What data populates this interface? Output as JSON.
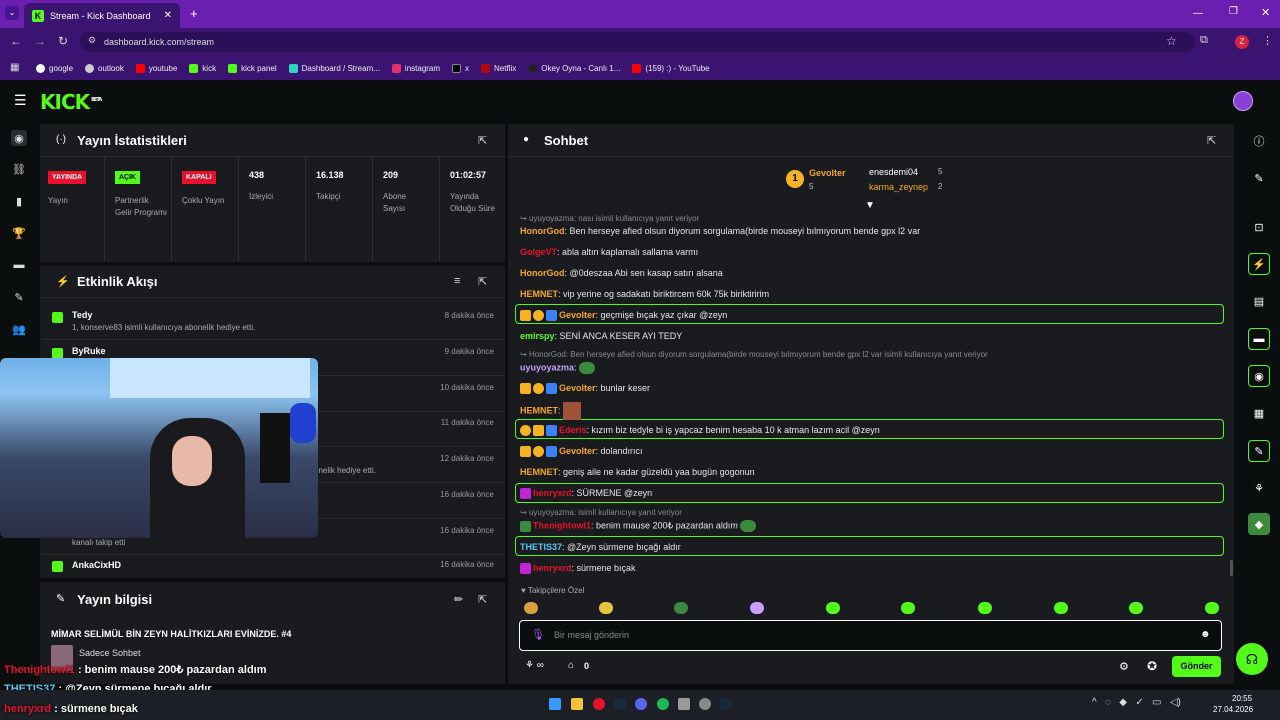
{
  "browser": {
    "tab_title": "Stream - Kick Dashboard",
    "url": "dashboard.kick.com/stream",
    "bookmarks": [
      "google",
      "outlook",
      "youtube",
      "kick",
      "kick panel",
      "Dashboard / Stream...",
      "instagram",
      "x",
      "Netflix",
      "Okey Oyna - Canlı 1...",
      "(159) :) - YouTube"
    ],
    "profile_initial": "Z"
  },
  "brand": {
    "logo": "KICK",
    "beta": "BETA"
  },
  "stats": {
    "title": "Yayın İstatistikleri",
    "items": [
      {
        "badge": "YAYINDA",
        "badge_color": "#e8102a",
        "label": "Yayın"
      },
      {
        "badge": "AÇIK",
        "badge_color": "#53fc18",
        "label": "Partnerlik Gelir Programı"
      },
      {
        "badge": "KAPALI",
        "badge_color": "#e8102a",
        "label": "Çoklu Yayın"
      },
      {
        "value": "438",
        "label": "İzleyici"
      },
      {
        "value": "16.138",
        "label": "Takipçi"
      },
      {
        "value": "209",
        "label": "Abone Sayısı"
      },
      {
        "value": "01:02:57",
        "label": "Yayında Olduğu Süre"
      }
    ]
  },
  "activity": {
    "title": "Etkinlik Akışı",
    "events": [
      {
        "name": "Tedy",
        "sub": "1, konserve83 isimli kullanıcıya abonelik hediye etti.",
        "time": "8 dakika önce"
      },
      {
        "name": "ByRuke",
        "sub": "",
        "time": "9 dakika önce"
      },
      {
        "name": "",
        "sub": "",
        "time": "10 dakika önce"
      },
      {
        "name": "",
        "sub": "",
        "time": "11 dakika önce"
      },
      {
        "name": "",
        "sub": "onelik hediye etti.",
        "time": "12 dakika önce"
      },
      {
        "name": "",
        "sub": "",
        "time": "16 dakika önce"
      },
      {
        "name": "",
        "sub": "kanalı takip etti",
        "time": "16 dakika önce"
      },
      {
        "name": "AnkaCixHD",
        "sub": "",
        "time": "16 dakika önce"
      }
    ]
  },
  "stream_info": {
    "title": "Yayın bilgisi",
    "stream_title": "MİMAR SELİMÜL BİN ZEYN HALİTKIZLARI EVİNİZDE. #4",
    "category": "Sadece Sohbet"
  },
  "chat": {
    "title": "Sohbet",
    "leaders": [
      {
        "name": "Gevolter",
        "count": "5"
      },
      {
        "name": "enesdemi04",
        "count": "5"
      },
      {
        "name": "karma_zeynep",
        "count": "2"
      }
    ],
    "rank_badge": "1",
    "messages": [
      {
        "type": "reply",
        "text": "uyuyoyazma: nası isimli kullanıcıya yanıt veriyor"
      },
      {
        "user": "HonorGod",
        "color": "#f5a623",
        "text": "Ben herseye afied olsun diyorum sorgulama(birde mouseyi bılmıyorum bende gpx l2 var"
      },
      {
        "user": "GolgeVT",
        "color": "#e8102a",
        "text": "abla altın kaplamalı sallama varmı"
      },
      {
        "user": "HonorGod",
        "color": "#f5a623",
        "text": "@0deszaa Abi sen kasap satırı alsana"
      },
      {
        "user": "HEMNET",
        "color": "#f5a623",
        "text": "vip yerine og sadakatı biriktircem 60k 75k biriktiririm"
      },
      {
        "user": "Gevolter",
        "color": "#f5a623",
        "text": "geçmişe bıçak yaz çıkar @zeyn",
        "highlight": true
      },
      {
        "user": "emirspy",
        "color": "#53fc18",
        "text": "SENİ ANCA KESER AYI TEDY"
      },
      {
        "type": "reply",
        "text": "HonorGod: Ben herseye afied olsun diyorum sorgulama(birde mouseyi bılmıyorum bende gpx l2 var isimli kullanıcıya yanıt veriyor"
      },
      {
        "user": "uyuyoyazma",
        "color": "#c9a0ff",
        "text": ""
      },
      {
        "user": "Gevolter",
        "color": "#f5a623",
        "text": "bunlar keser"
      },
      {
        "user": "HEMNET",
        "color": "#f5a623",
        "text": ""
      },
      {
        "user": "Ederis",
        "color": "#e8102a",
        "text": "kızım biz tedyle bi iş yapcaz benim hesaba 10 k atman lazım acil @zeyn",
        "highlight": true
      },
      {
        "user": "Gevolter",
        "color": "#f5a623",
        "text": "dolandırıcı"
      },
      {
        "user": "HEMNET",
        "color": "#f5a623",
        "text": "geniş aile ne kadar güzeldü yaa bugün gogonun"
      },
      {
        "user": "henryxrd",
        "color": "#e8102a",
        "text": "SÜRMENE @zeyn",
        "highlight": true
      },
      {
        "type": "reply",
        "text": "uyuyoyazma:  isimli kullanıcıya yanıt veriyor"
      },
      {
        "user": "Thenightowl1",
        "color": "#e8102a",
        "text": "benim mause 200₺ pazardan aldım"
      },
      {
        "user": "THETIS37",
        "color": "#53c8f5",
        "text": "@Zeyn sürmene bıçağı aldır",
        "highlight": true
      },
      {
        "user": "henryxrd",
        "color": "#e8102a",
        "text": "sürmene bıçak"
      }
    ],
    "followers_only": "Takipçilere Özel",
    "input_placeholder": "Bir mesaj gönderin",
    "send_label": "Gönder",
    "points": "0"
  },
  "overlay": [
    {
      "user": "Thenightowl1",
      "text": "benim mause 200₺ pazardan aldım"
    },
    {
      "user": "THETIS37",
      "text": "@Zeyn sürmene bıçağı aldır"
    },
    {
      "user": "henryxrd",
      "text": "sürmene bıçak"
    }
  ],
  "taskbar": {
    "time": "20:55",
    "date": "27.04.2026"
  },
  "colors": {
    "accent": "#53fc18",
    "bg": "#0b0e0f",
    "panel": "#191b1f",
    "browser": "#6b1fb1"
  }
}
